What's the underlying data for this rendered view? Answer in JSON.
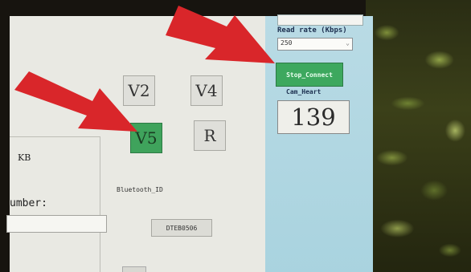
{
  "app": {
    "read_rate": {
      "label": "Read rate (Kbps)",
      "value": "250"
    },
    "stop_connect_label": "Stop_Connect",
    "cam_heart": {
      "label": "Cam_Heart",
      "value": "139"
    },
    "version_buttons": [
      "V2",
      "V4",
      "V5",
      "R"
    ],
    "kb_label": "KB",
    "number_label": "umber:",
    "number_value": "",
    "bluetooth": {
      "label": "Bluetooth_ID",
      "value": "DTEB0506"
    }
  },
  "colors": {
    "active_green": "#3fa35c",
    "sidebar_blue": "#b0d7e2",
    "annotation_red": "#d9262a"
  },
  "icons": [
    "dropdown-chevron-icon",
    "arrow-pointer-icon"
  ]
}
